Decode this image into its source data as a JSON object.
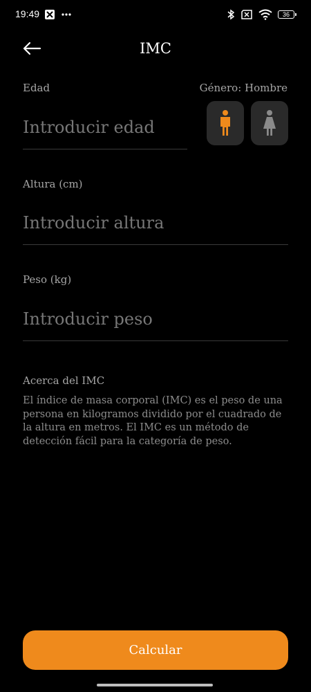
{
  "status_bar": {
    "time": "19:49",
    "battery": "36"
  },
  "header": {
    "title": "IMC"
  },
  "age": {
    "label": "Edad",
    "placeholder": "Introducir edad"
  },
  "gender": {
    "label": "Género: Hombre",
    "selected": "male",
    "active_color": "#ef8a1c",
    "inactive_color": "#8a8a8a"
  },
  "height": {
    "label": "Altura (cm)",
    "placeholder": "Introducir altura"
  },
  "weight": {
    "label": "Peso (kg)",
    "placeholder": "Introducir peso"
  },
  "about": {
    "title": "Acerca del IMC",
    "text": "El índice de masa corporal (IMC) es el peso de una persona en kilogramos dividido por el cuadrado de la altura en metros. El IMC es un método de detección fácil para la categoría de peso."
  },
  "actions": {
    "calculate_label": "Calcular",
    "accent": "#ef8a1c"
  },
  "icons": {
    "back": "arrow-left-icon",
    "male": "male-figure-icon",
    "female": "female-figure-icon"
  }
}
